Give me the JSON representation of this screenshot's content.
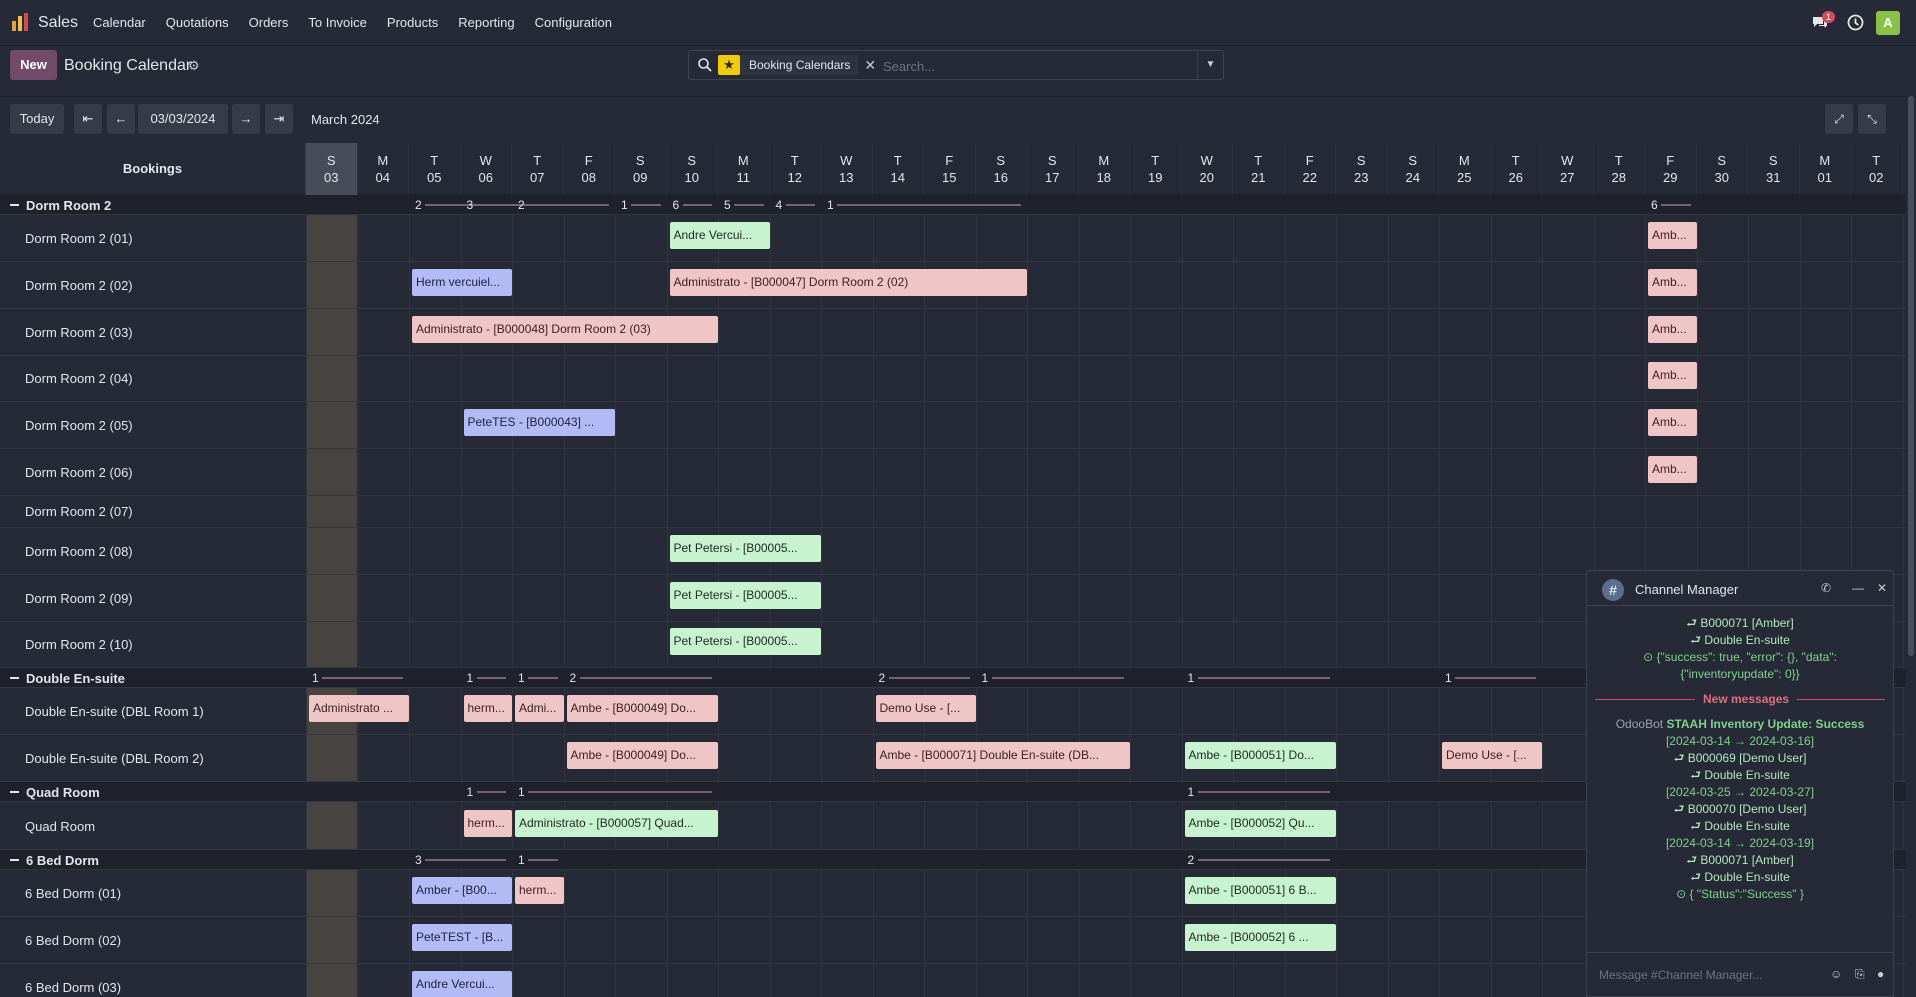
{
  "app": {
    "name": "Sales"
  },
  "menu": [
    "Calendar",
    "Quotations",
    "Orders",
    "To Invoice",
    "Products",
    "Reporting",
    "Configuration"
  ],
  "systray": {
    "chat_count": "1",
    "avatar": "A"
  },
  "control": {
    "new_label": "New",
    "title": "Booking Calendar"
  },
  "search": {
    "facet": "Booking Calendars",
    "placeholder": "Search..."
  },
  "toolbar": {
    "today": "Today",
    "date": "03/03/2024",
    "month": "March 2024"
  },
  "bookings_header": "Bookings",
  "days": [
    {
      "d": "S",
      "n": "03"
    },
    {
      "d": "M",
      "n": "04"
    },
    {
      "d": "T",
      "n": "05"
    },
    {
      "d": "W",
      "n": "06"
    },
    {
      "d": "T",
      "n": "07"
    },
    {
      "d": "F",
      "n": "08"
    },
    {
      "d": "S",
      "n": "09"
    },
    {
      "d": "S",
      "n": "10"
    },
    {
      "d": "M",
      "n": "11"
    },
    {
      "d": "T",
      "n": "12"
    },
    {
      "d": "W",
      "n": "13"
    },
    {
      "d": "T",
      "n": "14"
    },
    {
      "d": "F",
      "n": "15"
    },
    {
      "d": "S",
      "n": "16"
    },
    {
      "d": "S",
      "n": "17"
    },
    {
      "d": "M",
      "n": "18"
    },
    {
      "d": "T",
      "n": "19"
    },
    {
      "d": "W",
      "n": "20"
    },
    {
      "d": "T",
      "n": "21"
    },
    {
      "d": "F",
      "n": "22"
    },
    {
      "d": "S",
      "n": "23"
    },
    {
      "d": "S",
      "n": "24"
    },
    {
      "d": "M",
      "n": "25"
    },
    {
      "d": "T",
      "n": "26"
    },
    {
      "d": "W",
      "n": "27"
    },
    {
      "d": "T",
      "n": "28"
    },
    {
      "d": "F",
      "n": "29"
    },
    {
      "d": "S",
      "n": "30"
    },
    {
      "d": "S",
      "n": "31"
    },
    {
      "d": "M",
      "n": "01"
    },
    {
      "d": "T",
      "n": "02"
    }
  ],
  "groups": [
    {
      "name": "Dorm Room 2",
      "counts": [
        {
          "v": "2",
          "s": 2,
          "e": 4
        },
        {
          "v": "3",
          "s": 3,
          "e": 5
        },
        {
          "v": "2",
          "s": 4,
          "e": 6
        },
        {
          "v": "1",
          "s": 6,
          "e": 7
        },
        {
          "v": "6",
          "s": 7,
          "e": 8
        },
        {
          "v": "5",
          "s": 8,
          "e": 9
        },
        {
          "v": "4",
          "s": 9,
          "e": 10
        },
        {
          "v": "1",
          "s": 10,
          "e": 14
        },
        {
          "v": "6",
          "s": 26,
          "e": 27
        }
      ],
      "rows": [
        {
          "label": "Dorm Room 2 (01)",
          "h": 46,
          "items": [
            {
              "t": "Andre Vercui...",
              "c": "green",
              "s": 7,
              "e": 9
            },
            {
              "t": "Amb...",
              "c": "red",
              "s": 26,
              "e": 27
            }
          ]
        },
        {
          "label": "Dorm Room 2 (02)",
          "h": 47,
          "items": [
            {
              "t": "Herm vercuiel...",
              "c": "blue",
              "s": 2,
              "e": 4
            },
            {
              "t": "Administrato - [B000047] Dorm Room 2 (02)",
              "c": "red",
              "s": 7,
              "e": 14
            },
            {
              "t": "Amb...",
              "c": "red",
              "s": 26,
              "e": 27
            }
          ]
        },
        {
          "label": "Dorm Room 2 (03)",
          "h": 47,
          "items": [
            {
              "t": "Administrato - [B000048] Dorm Room 2 (03)",
              "c": "red",
              "s": 2,
              "e": 8
            },
            {
              "t": "Amb...",
              "c": "red",
              "s": 26,
              "e": 27
            }
          ]
        },
        {
          "label": "Dorm Room 2 (04)",
          "h": 46,
          "items": [
            {
              "t": "Amb...",
              "c": "red",
              "s": 26,
              "e": 27
            }
          ]
        },
        {
          "label": "Dorm Room 2 (05)",
          "h": 47,
          "items": [
            {
              "t": "PeteTES - [B000043] ...",
              "c": "blue",
              "s": 3,
              "e": 6
            },
            {
              "t": "Amb...",
              "c": "red",
              "s": 26,
              "e": 27
            }
          ]
        },
        {
          "label": "Dorm Room 2 (06)",
          "h": 47,
          "items": [
            {
              "t": "Amb...",
              "c": "red",
              "s": 26,
              "e": 27
            }
          ]
        },
        {
          "label": "Dorm Room 2 (07)",
          "h": 32,
          "items": []
        },
        {
          "label": "Dorm Room 2 (08)",
          "h": 47,
          "items": [
            {
              "t": "Pet Petersi - [B00005...",
              "c": "green",
              "s": 7,
              "e": 10
            }
          ]
        },
        {
          "label": "Dorm Room 2 (09)",
          "h": 47,
          "items": [
            {
              "t": "Pet Petersi - [B00005...",
              "c": "green",
              "s": 7,
              "e": 10
            }
          ]
        },
        {
          "label": "Dorm Room 2 (10)",
          "h": 46,
          "items": [
            {
              "t": "Pet Petersi - [B00005...",
              "c": "green",
              "s": 7,
              "e": 10
            }
          ]
        }
      ]
    },
    {
      "name": "Double En-suite",
      "counts": [
        {
          "v": "1",
          "s": 0,
          "e": 2
        },
        {
          "v": "1",
          "s": 3,
          "e": 4
        },
        {
          "v": "1",
          "s": 4,
          "e": 5
        },
        {
          "v": "2",
          "s": 5,
          "e": 8
        },
        {
          "v": "2",
          "s": 11,
          "e": 13
        },
        {
          "v": "1",
          "s": 13,
          "e": 16
        },
        {
          "v": "1",
          "s": 17,
          "e": 20
        },
        {
          "v": "1",
          "s": 22,
          "e": 24
        }
      ],
      "rows": [
        {
          "label": "Double En-suite (DBL Room 1)",
          "h": 46,
          "items": [
            {
              "t": "Administrato ...",
              "c": "red",
              "s": 0,
              "e": 2
            },
            {
              "t": "herm...",
              "c": "red",
              "s": 3,
              "e": 4
            },
            {
              "t": "Admi...",
              "c": "red",
              "s": 4,
              "e": 5
            },
            {
              "t": "Ambe - [B000049] Do...",
              "c": "red",
              "s": 5,
              "e": 8
            },
            {
              "t": "Demo Use - [...",
              "c": "red",
              "s": 11,
              "e": 13
            }
          ]
        },
        {
          "label": "Double En-suite (DBL Room 2)",
          "h": 47,
          "items": [
            {
              "t": "Ambe - [B000049] Do...",
              "c": "red",
              "s": 5,
              "e": 8
            },
            {
              "t": "Ambe - [B000071] Double En-suite (DB...",
              "c": "red",
              "s": 11,
              "e": 16
            },
            {
              "t": "Ambe - [B000051] Do...",
              "c": "green",
              "s": 17,
              "e": 20
            },
            {
              "t": "Demo Use - [...",
              "c": "red",
              "s": 22,
              "e": 24
            }
          ]
        }
      ]
    },
    {
      "name": "Quad Room",
      "counts": [
        {
          "v": "1",
          "s": 3,
          "e": 4
        },
        {
          "v": "1",
          "s": 4,
          "e": 8
        },
        {
          "v": "1",
          "s": 17,
          "e": 20
        }
      ],
      "rows": [
        {
          "label": "Quad Room",
          "h": 47,
          "items": [
            {
              "t": "herm...",
              "c": "red",
              "s": 3,
              "e": 4
            },
            {
              "t": "Administrato - [B000057] Quad...",
              "c": "green",
              "s": 4,
              "e": 8
            },
            {
              "t": "Ambe - [B000052] Qu...",
              "c": "green",
              "s": 17,
              "e": 20
            }
          ]
        }
      ]
    },
    {
      "name": "6 Bed Dorm",
      "counts": [
        {
          "v": "3",
          "s": 2,
          "e": 4
        },
        {
          "v": "1",
          "s": 4,
          "e": 5
        },
        {
          "v": "2",
          "s": 17,
          "e": 20
        }
      ],
      "rows": [
        {
          "label": "6 Bed Dorm (01)",
          "h": 46,
          "items": [
            {
              "t": "Amber - [B00...",
              "c": "blue",
              "s": 2,
              "e": 4
            },
            {
              "t": "herm...",
              "c": "red",
              "s": 4,
              "e": 5
            },
            {
              "t": "Ambe - [B000051] 6 B...",
              "c": "green",
              "s": 17,
              "e": 20
            }
          ]
        },
        {
          "label": "6 Bed Dorm (02)",
          "h": 47,
          "items": [
            {
              "t": "PeteTEST - [B...",
              "c": "blue",
              "s": 2,
              "e": 4
            },
            {
              "t": "Ambe - [B000052] 6 ...",
              "c": "green",
              "s": 17,
              "e": 20
            }
          ]
        },
        {
          "label": "6 Bed Dorm (03)",
          "h": 47,
          "items": [
            {
              "t": "Andre Vercui...",
              "c": "blue",
              "s": 2,
              "e": 4
            }
          ]
        }
      ]
    }
  ],
  "chat": {
    "title": "Channel Manager",
    "lines": [
      {
        "t": "⮐ B000071 [Amber]",
        "k": "sub"
      },
      {
        "t": "⮐ Double En-suite",
        "k": "sub"
      },
      {
        "t": "⊙ {\"success\": true, \"error\": {}, \"data\":",
        "k": "g"
      },
      {
        "t": "{\"inventoryupdate\": 0}}",
        "k": "g"
      }
    ],
    "new_messages": "New messages",
    "author": "OdooBot",
    "msg_title": "STAAH Inventory Update: Success",
    "lines2": [
      {
        "t": "[2024-03-14 → 2024-03-16]",
        "k": "g"
      },
      {
        "t": "⮐ B000069 [Demo User]",
        "k": "sub"
      },
      {
        "t": "⮐ Double En-suite",
        "k": "sub"
      },
      {
        "t": "[2024-03-25 → 2024-03-27]",
        "k": "g"
      },
      {
        "t": "⮐ B000070 [Demo User]",
        "k": "sub"
      },
      {
        "t": "⮐ Double En-suite",
        "k": "sub"
      },
      {
        "t": "[2024-03-14 → 2024-03-19]",
        "k": "g"
      },
      {
        "t": "⮐ B000071 [Amber]",
        "k": "sub"
      },
      {
        "t": "⮐ Double En-suite",
        "k": "sub"
      },
      {
        "t": "⊙ { \"Status\":\"Success\" }",
        "k": "g"
      }
    ],
    "placeholder": "Message #Channel Manager..."
  },
  "colors": {
    "accent": "#714b67",
    "green": "#c7f3cf",
    "red": "#f0c5c6",
    "blue": "#b3bbf6",
    "today": "#464341"
  }
}
